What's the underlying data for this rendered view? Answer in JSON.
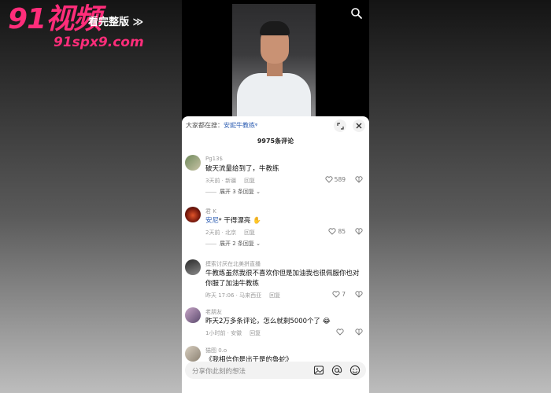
{
  "watermark": {
    "brand": "91视频",
    "tagline": "看完整版 ≫",
    "url": "91spx9.com"
  },
  "video": {
    "search_icon": "search-icon"
  },
  "sheet": {
    "search_prefix": "大家都在搜：",
    "search_link": "安妮牛教练",
    "search_suffix": "ᵠ",
    "comment_count": "9975条评论"
  },
  "comments": [
    {
      "user": "Pg13$",
      "text": "破天流量给到了，牛教练",
      "time_loc": "3天前 · 新疆",
      "reply": "回复",
      "likes": "589",
      "expand": "展开 3 条回复 ⌄"
    },
    {
      "user": "君 K",
      "text_link": "安尼",
      "text_suffix": "ᵠ 干得漂亮 ✋",
      "time_loc": "2天前 · 北京",
      "reply": "回复",
      "likes": "85",
      "expand": "展开 2 条回复 ⌄"
    },
    {
      "user": "摸索讨厌在北美拼直播",
      "text": "牛教练虽然我很不喜欢你但是加油我也很佩服你也对你服了加油牛教练",
      "time_loc": "昨天 17:06 · 马来西亚",
      "reply": "回复",
      "likes": "7"
    },
    {
      "user": "老朋友",
      "text": "昨天2万多条评论，怎么就剩5000个了 😂",
      "time_loc": "1小时前 · 安徽",
      "reply": "回复",
      "likes": ""
    },
    {
      "user": "猫图 0.o",
      "text": "《我相信你是出于是的魯蛇》",
      "time_loc": "",
      "reply": "",
      "likes": ""
    }
  ],
  "input": {
    "placeholder": "分享你此刻的想法"
  },
  "colors": {
    "accent": "#ff2d7a",
    "link": "#2f5fb3"
  }
}
